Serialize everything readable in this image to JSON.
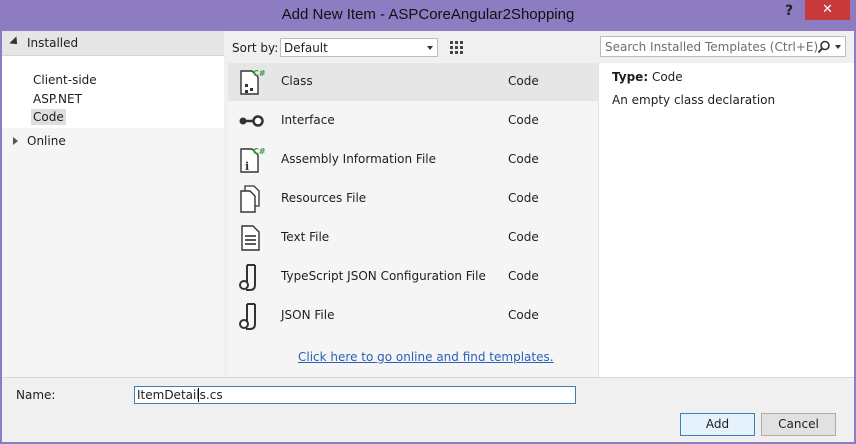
{
  "window": {
    "title": "Add New Item - ASPCoreAngular2Shopping",
    "help_glyph": "?",
    "close_glyph": "✕"
  },
  "tree": {
    "installed_label": "Installed",
    "children": [
      "Client-side",
      "ASP.NET",
      "Code"
    ],
    "selected_child": "Code",
    "online_label": "Online"
  },
  "toolbar": {
    "sort_label": "Sort by:",
    "sort_value": "Default",
    "search_placeholder": "Search Installed Templates (Ctrl+E)"
  },
  "templates": [
    {
      "name": "Class",
      "type": "Code",
      "icon": "class-icon"
    },
    {
      "name": "Interface",
      "type": "Code",
      "icon": "interface-icon"
    },
    {
      "name": "Assembly Information File",
      "type": "Code",
      "icon": "assembly-info-icon"
    },
    {
      "name": "Resources File",
      "type": "Code",
      "icon": "resources-file-icon"
    },
    {
      "name": "Text File",
      "type": "Code",
      "icon": "text-file-icon"
    },
    {
      "name": "TypeScript JSON Configuration File",
      "type": "Code",
      "icon": "json-config-icon"
    },
    {
      "name": "JSON File",
      "type": "Code",
      "icon": "json-file-icon"
    }
  ],
  "online_link": "Click here to go online and find templates.",
  "details": {
    "type_label": "Type:",
    "type_value": "Code",
    "description": "An empty class declaration"
  },
  "bottom": {
    "name_label": "Name:",
    "name_value": "ItemDetails.cs",
    "add_label": "Add",
    "cancel_label": "Cancel"
  },
  "colors": {
    "title_bg": "#8e7cc3",
    "close_bg": "#c7393a",
    "link": "#2961ba",
    "csharp_green": "#3a9a3a"
  }
}
